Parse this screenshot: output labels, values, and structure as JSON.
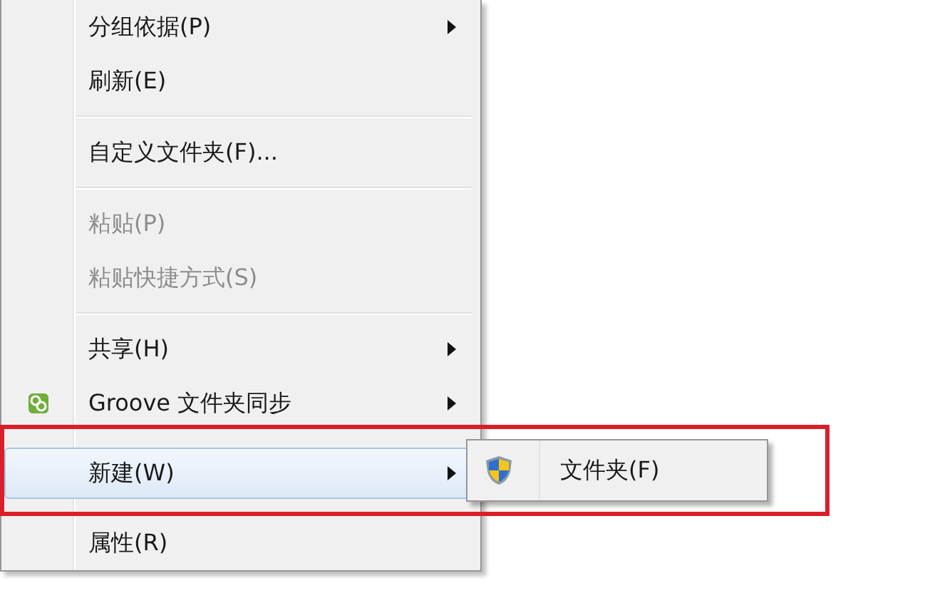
{
  "menu": {
    "items": [
      {
        "kind": "item",
        "label": "分组依据(P)",
        "has_submenu": true,
        "disabled": false,
        "selected": false
      },
      {
        "kind": "item",
        "label": "刷新(E)",
        "has_submenu": false,
        "disabled": false,
        "selected": false
      },
      {
        "kind": "separator"
      },
      {
        "kind": "item",
        "label": "自定义文件夹(F)...",
        "has_submenu": false,
        "disabled": false,
        "selected": false
      },
      {
        "kind": "separator"
      },
      {
        "kind": "item",
        "label": "粘贴(P)",
        "has_submenu": false,
        "disabled": true,
        "selected": false
      },
      {
        "kind": "item",
        "label": "粘贴快捷方式(S)",
        "has_submenu": false,
        "disabled": true,
        "selected": false
      },
      {
        "kind": "separator"
      },
      {
        "kind": "item",
        "label": "共享(H)",
        "has_submenu": true,
        "disabled": false,
        "selected": false
      },
      {
        "kind": "item",
        "label": "Groove 文件夹同步",
        "has_submenu": true,
        "disabled": false,
        "selected": false,
        "icon": true
      },
      {
        "kind": "item",
        "label": "新建(W)",
        "has_submenu": true,
        "disabled": false,
        "selected": true,
        "submenu": [
          {
            "label": "文件夹(F)"
          }
        ]
      },
      {
        "kind": "item",
        "label": "属性(R)",
        "has_submenu": false,
        "disabled": false,
        "selected": false
      }
    ]
  }
}
